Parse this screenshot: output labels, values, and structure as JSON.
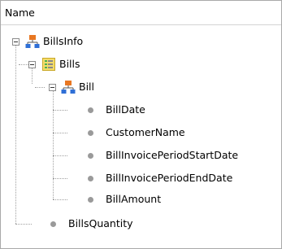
{
  "header": {
    "column_name": "Name"
  },
  "tree": {
    "root": {
      "label": "BillsInfo",
      "icon": "structure-icon"
    },
    "bills": {
      "label": "Bills",
      "icon": "collection-icon"
    },
    "bill": {
      "label": "Bill",
      "icon": "structure-icon"
    },
    "bill_fields": [
      {
        "label": "BillDate",
        "icon": "attribute-icon"
      },
      {
        "label": "CustomerName",
        "icon": "attribute-icon"
      },
      {
        "label": "BillInvoicePeriodStartDate",
        "icon": "attribute-icon"
      },
      {
        "label": "BillInvoicePeriodEndDate",
        "icon": "attribute-icon"
      },
      {
        "label": "BillAmount",
        "icon": "attribute-icon"
      }
    ],
    "bills_quantity": {
      "label": "BillsQuantity",
      "icon": "attribute-icon"
    }
  },
  "colors": {
    "structure_orange": "#e87722",
    "structure_blue": "#2f6fd6",
    "collection_yellow": "#f3dc6b",
    "collection_green": "#4caf50"
  }
}
